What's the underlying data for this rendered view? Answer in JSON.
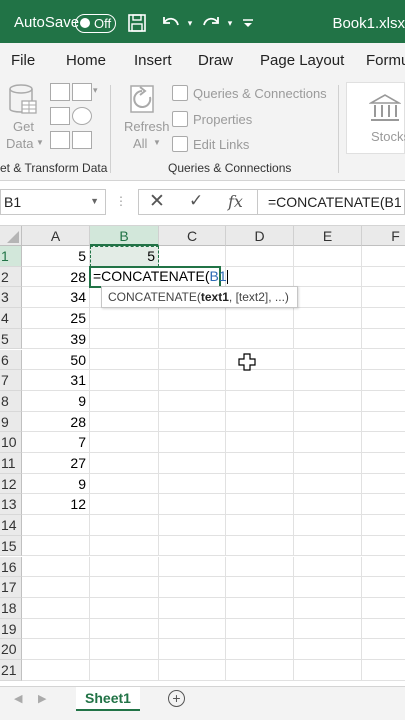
{
  "titlebar": {
    "autosave_label": "AutoSave",
    "toggle_state": "Off",
    "book_title": "Book1.xlsx"
  },
  "tabs": [
    "File",
    "Home",
    "Insert",
    "Draw",
    "Page Layout",
    "Formu"
  ],
  "ribbon": {
    "get_data_line1": "Get",
    "get_data_line2": "Data",
    "refresh_line1": "Refresh",
    "refresh_line2": "All",
    "queries_connections": "Queries & Connections",
    "properties": "Properties",
    "edit_links": "Edit Links",
    "stocks": "Stocks",
    "group_get_transform": "et & Transform Data",
    "group_queries": "Queries & Connections"
  },
  "formula_bar": {
    "name_box": "B1",
    "formula": "=CONCATENATE(B1"
  },
  "grid": {
    "columns": [
      "A",
      "B",
      "C",
      "D",
      "E",
      "F"
    ],
    "rows": [
      "1",
      "2",
      "3",
      "4",
      "5",
      "6",
      "7",
      "8",
      "9",
      "10",
      "11",
      "12",
      "13",
      "14",
      "15",
      "16",
      "17",
      "18",
      "19",
      "20",
      "21"
    ],
    "col_a_values": [
      "5",
      "28",
      "34",
      "25",
      "39",
      "50",
      "31",
      "9",
      "28",
      "7",
      "27",
      "9",
      "12"
    ],
    "b1_value": "5",
    "editing": {
      "prefix": "=CONCATENATE(",
      "ref": "B1"
    },
    "tooltip": {
      "fn": "CONCATENATE(",
      "arg1": "text1",
      "rest": ", [text2], ...)"
    }
  },
  "sheets": {
    "active": "Sheet1"
  },
  "colors": {
    "excel_green": "#217346",
    "ribbon_bg": "#f3f3f3",
    "header_bg": "#eaeaea",
    "selected_header_bg": "#d2e7da",
    "reference_blue": "#2e6bb5"
  }
}
